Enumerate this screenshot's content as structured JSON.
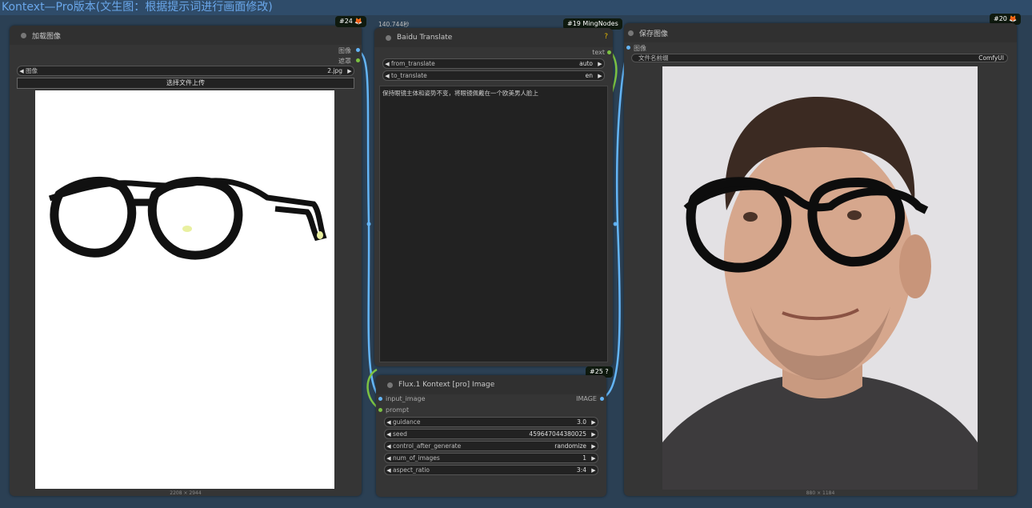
{
  "group": {
    "title": "Kontext—Pro版本(文生图：根据提示词进行画面修改)"
  },
  "load_image": {
    "badge": "#24 🦊",
    "title": "加载图像",
    "outputs": [
      "图像",
      "遮罩"
    ],
    "image_widget": {
      "label": "图像",
      "value": "2.jpg"
    },
    "upload_label": "选择文件上传",
    "dims": "2208 × 2944"
  },
  "baidu": {
    "time": "140.744秒",
    "badge": "#19 MingNodes",
    "title": "Baidu Translate",
    "help": "?",
    "output": "text",
    "from": {
      "label": "from_translate",
      "value": "auto"
    },
    "to": {
      "label": "to_translate",
      "value": "en"
    },
    "text": "保持眼镜主体和姿势不变，将眼镜佩戴在一个欧美男人脸上"
  },
  "flux": {
    "badge": "#25 ?",
    "title": "Flux.1 Kontext [pro] Image",
    "input_image": "input_image",
    "output": "IMAGE",
    "prompt": "prompt",
    "widgets": [
      {
        "label": "guidance",
        "value": "3.0"
      },
      {
        "label": "seed",
        "value": "459647044380025"
      },
      {
        "label": "control_after_generate",
        "value": "randomize"
      },
      {
        "label": "num_of_images",
        "value": "1"
      },
      {
        "label": "aspect_ratio",
        "value": "3:4"
      }
    ]
  },
  "save_image": {
    "badge": "#20 🦊",
    "title": "保存图像",
    "input": "图像",
    "prefix": {
      "label": "文件名前缀",
      "value": "ComfyUI"
    },
    "dims": "880 × 1184"
  },
  "colors": {
    "image_link": "#64b5f6",
    "string_link": "#7cc242"
  }
}
